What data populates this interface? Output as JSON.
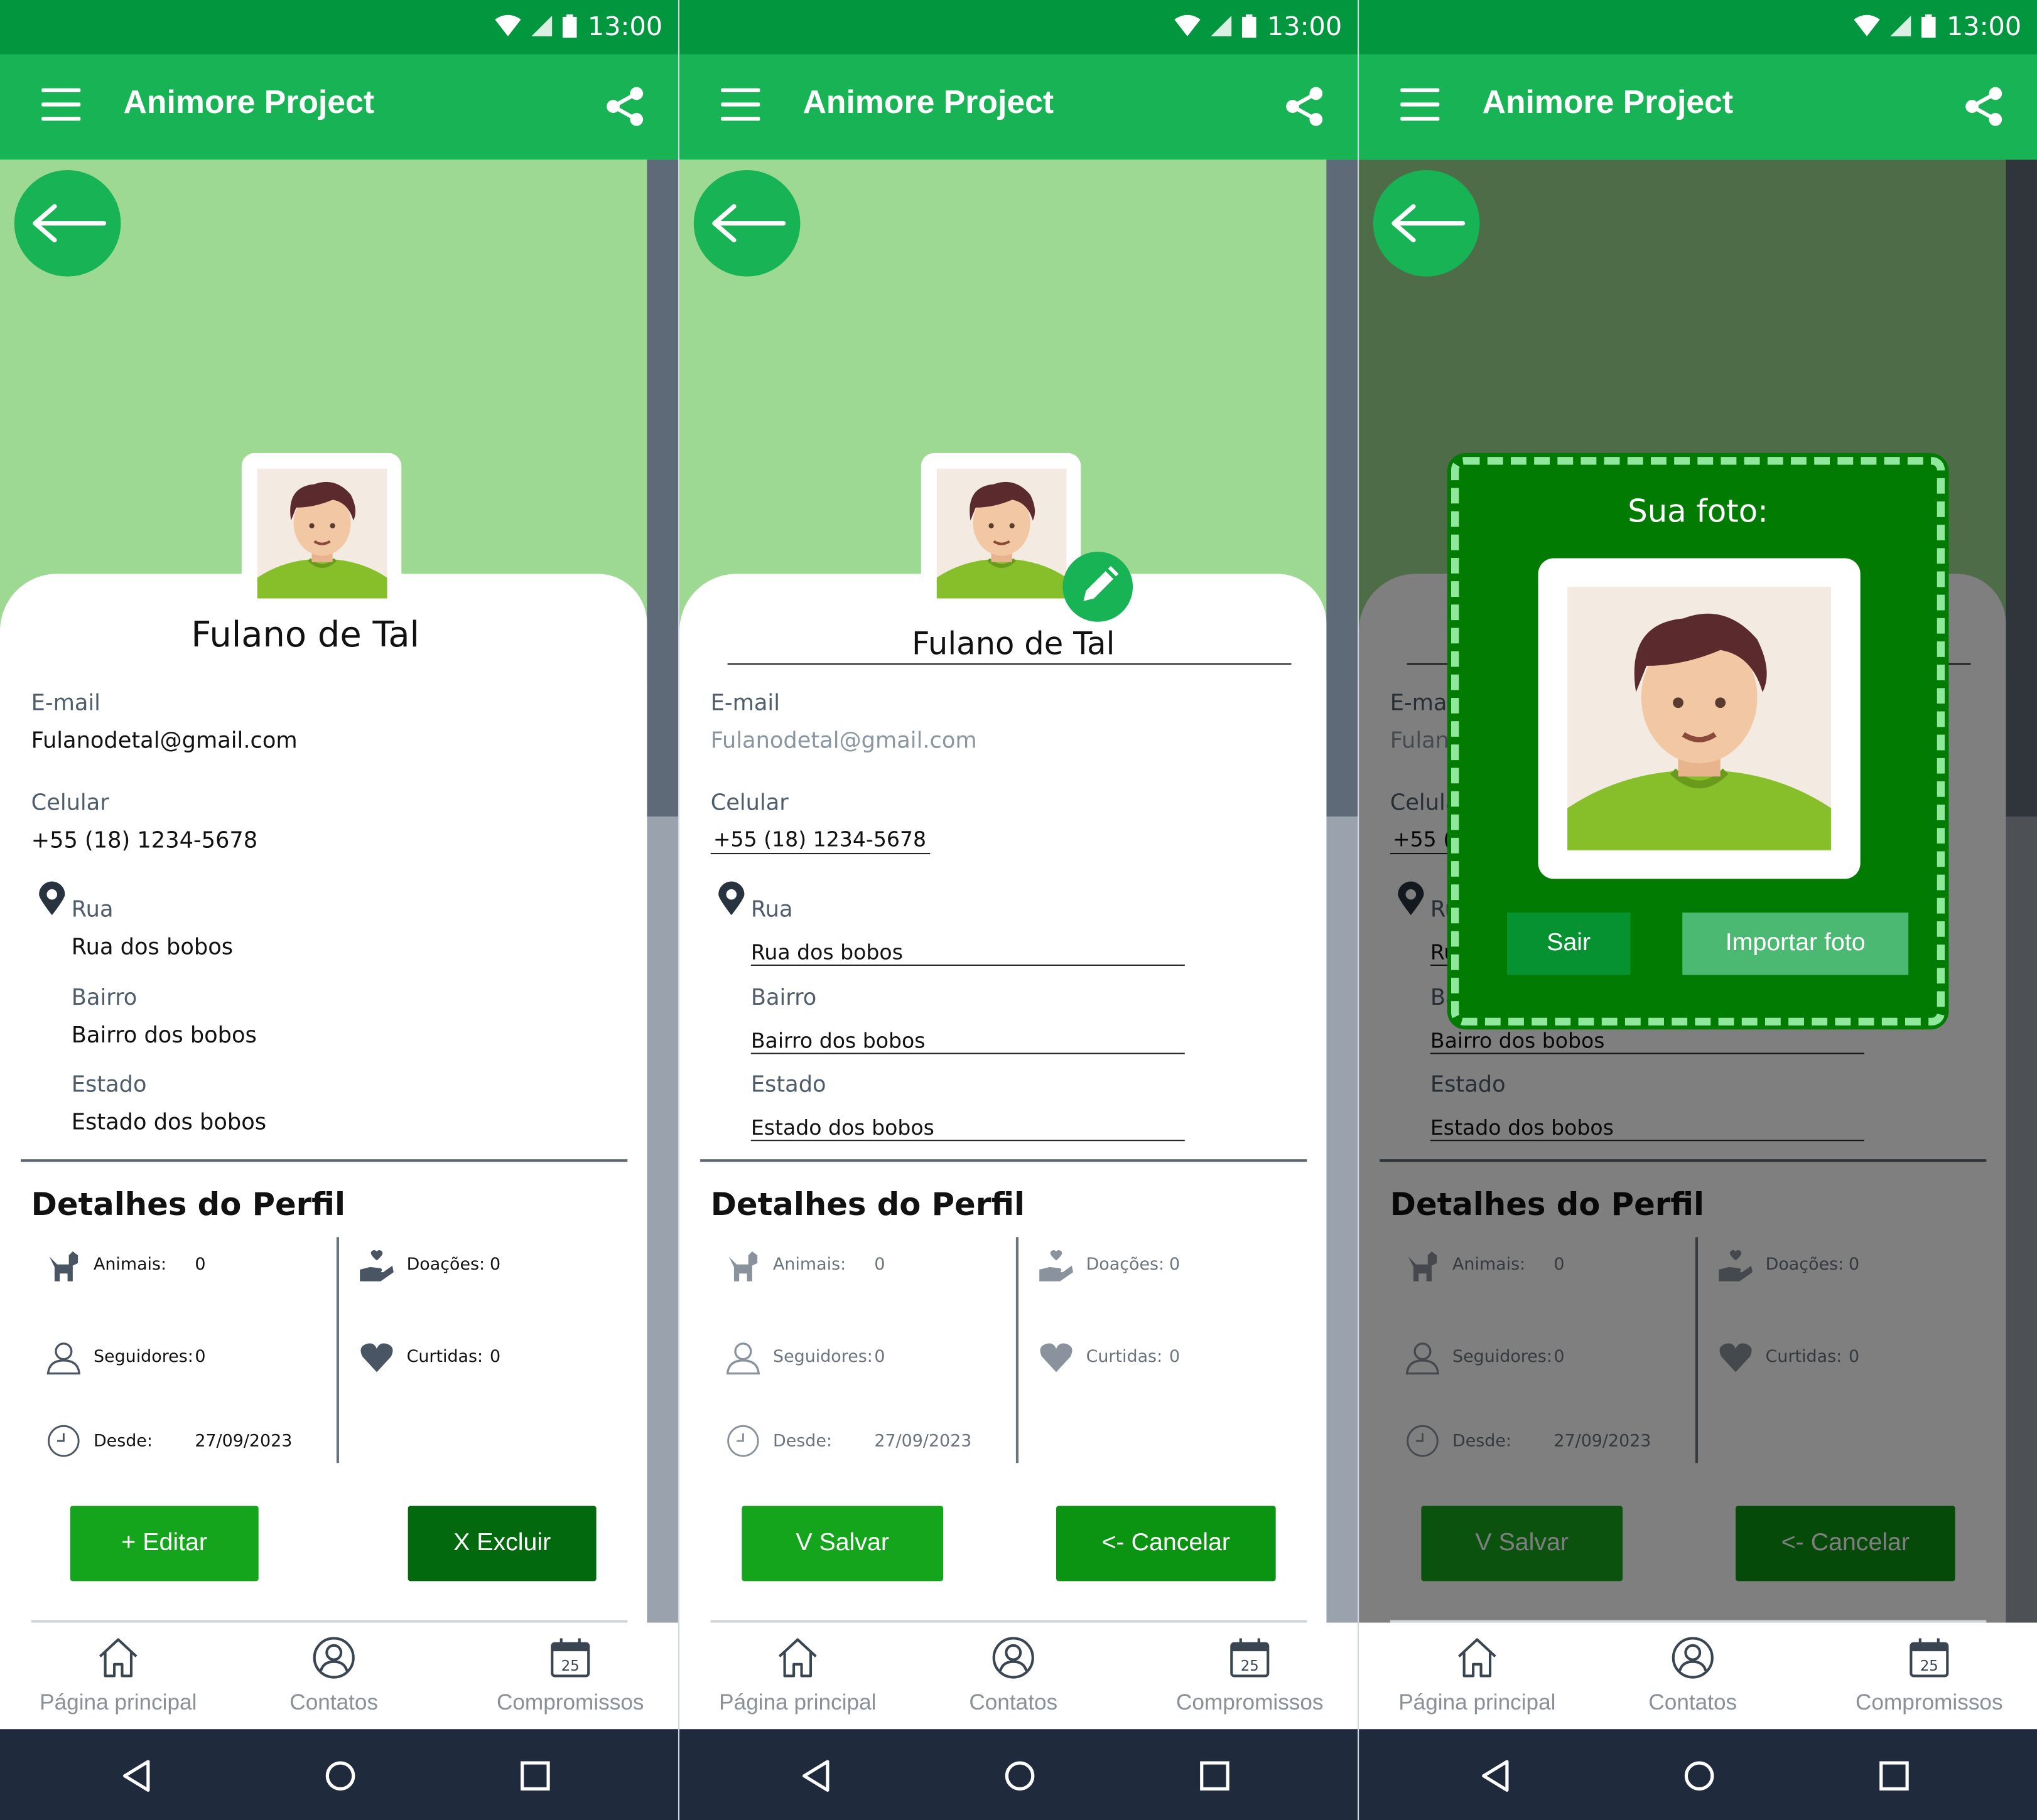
{
  "status_bar": {
    "time": "13:00"
  },
  "app_bar": {
    "title": "Animore Project"
  },
  "profile": {
    "name": "Fulano de Tal",
    "email_label": "E-mail",
    "email": "Fulanodetal@gmail.com",
    "phone_label": "Celular",
    "phone": "+55 (18) 1234-5678",
    "street_label": "Rua",
    "street": "Rua dos bobos",
    "district_label": "Bairro",
    "district": "Bairro dos bobos",
    "state_label": "Estado",
    "state": "Estado dos bobos"
  },
  "details": {
    "title": "Detalhes do Perfil",
    "animals_label": "Animais:",
    "animals_value": "0",
    "donations_label": "Doações:",
    "donations_value": "0",
    "followers_label": "Seguidores:",
    "followers_value": "0",
    "likes_label": "Curtidas:",
    "likes_value": "0",
    "since_label": "Desde:",
    "since_value": "27/09/2023"
  },
  "buttons": {
    "edit": "+ Editar",
    "delete": "X Excluir",
    "save": "V Salvar",
    "cancel": "<- Cancelar"
  },
  "tabs": {
    "home": "Página principal",
    "contacts": "Contatos",
    "appointments": "Compromissos",
    "calendar_day": "25"
  },
  "photo_dialog": {
    "title": "Sua foto:",
    "exit": "Sair",
    "import": "Importar foto"
  },
  "colors": {
    "status_bar": "#02963f",
    "app_bar": "#17b355",
    "hero": "#9ed993",
    "button_green": "#14a51c",
    "button_dark": "#03690f",
    "dialog": "#027b02",
    "dialog_border": "#8fe89b",
    "nav_bar": "#1f2a3c"
  },
  "icons": [
    "menu-icon",
    "share-icon",
    "back-arrow-icon",
    "location-pin-icon",
    "dog-icon",
    "donation-icon",
    "user-icon",
    "heart-icon",
    "clock-icon",
    "home-icon",
    "contacts-icon",
    "calendar-icon",
    "nav-back-icon",
    "nav-home-icon",
    "nav-recents-icon",
    "pencil-icon",
    "wifi-icon",
    "signal-icon",
    "battery-icon"
  ]
}
